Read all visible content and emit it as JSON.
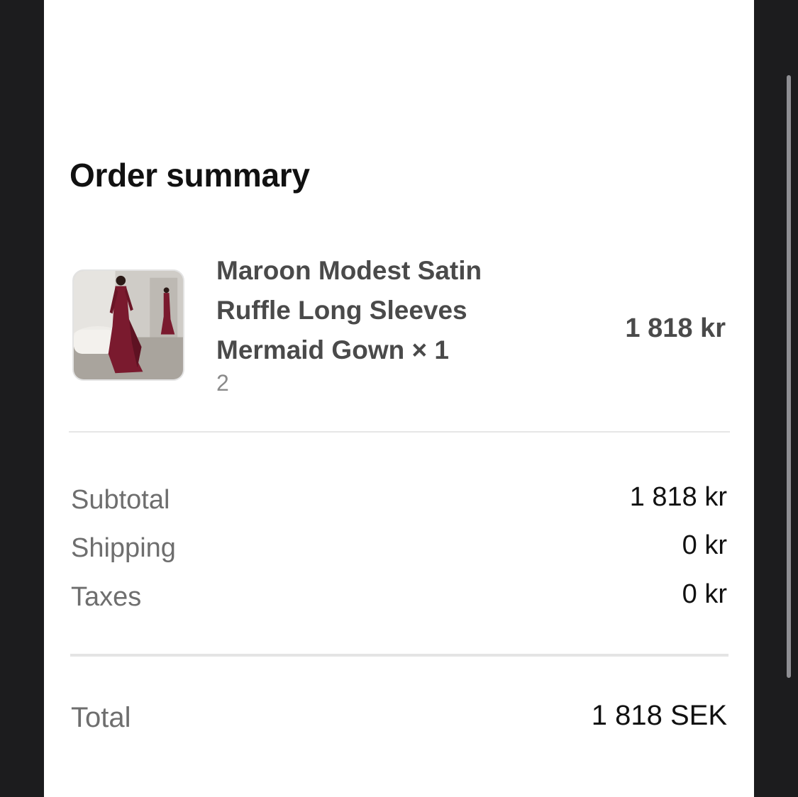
{
  "order_summary": {
    "title": "Order summary",
    "item": {
      "name": "Maroon Modest Satin Ruffle Long Sleeves Mermaid Gown × 1",
      "variant": "2",
      "price": "1 818 kr",
      "image_icon": "product-photo-maroon-gown"
    },
    "rows": [
      {
        "label": "Subtotal",
        "value": "1 818 kr"
      },
      {
        "label": "Shipping",
        "value": "0 kr"
      },
      {
        "label": "Taxes",
        "value": "0 kr"
      }
    ],
    "total": {
      "label": "Total",
      "value": "1 818 SEK"
    }
  },
  "colors": {
    "background": "#1c1c1e",
    "surface": "#ffffff",
    "gown": "#7a1a2e"
  }
}
